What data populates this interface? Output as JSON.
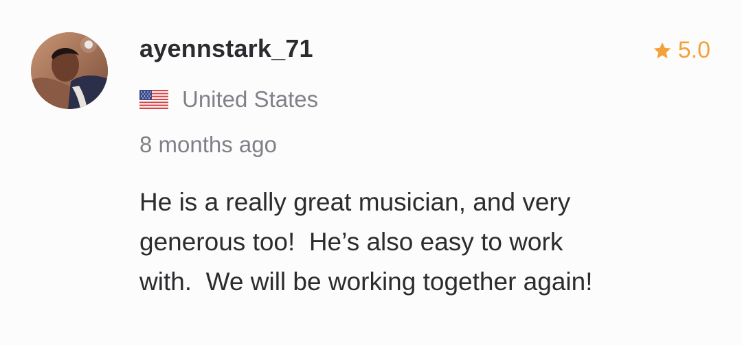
{
  "review": {
    "username": "ayennstark_71",
    "rating": "5.0",
    "country": "United States",
    "country_flag_icon": "us-flag-icon",
    "time_ago": "8 months ago",
    "text_lines": [
      "He is a really great musician, and very",
      "generous too!  He’s also easy to work",
      "with.  We will be working together again!"
    ]
  },
  "colors": {
    "background": "#fcfcfc",
    "username": "#2b2a2e",
    "muted_text": "#808088",
    "rating_star": "#f3a23a",
    "body_text": "#2c2b2e"
  },
  "icons": {
    "rating": "star-icon",
    "avatar": "avatar"
  }
}
